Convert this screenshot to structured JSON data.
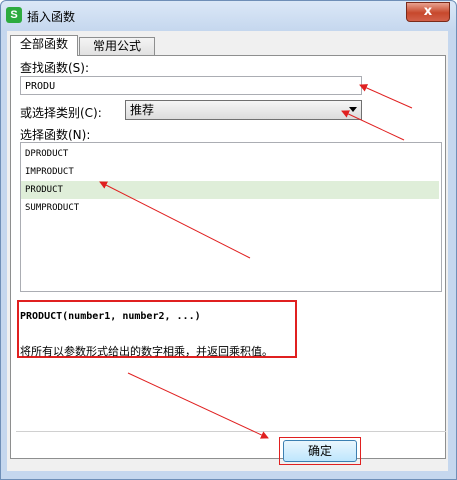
{
  "window": {
    "icon_letter": "S",
    "title": "插入函数",
    "close_label": "x"
  },
  "tabs": [
    {
      "label": "全部函数"
    },
    {
      "label": "常用公式"
    }
  ],
  "search": {
    "label": "查找函数(S):",
    "value": "PRODU"
  },
  "category": {
    "label": "或选择类别(C):",
    "selected": "推荐"
  },
  "functions": {
    "label": "选择函数(N):",
    "items": [
      "DPRODUCT",
      "IMPRODUCT",
      "PRODUCT",
      "SUMPRODUCT"
    ],
    "selected_index": 2
  },
  "description": {
    "signature": "PRODUCT(number1, number2, ...)",
    "text": "将所有以参数形式给出的数字相乘，并返回乘积值。"
  },
  "ok_button": {
    "label": "确定"
  },
  "annotation_color": "#e02020"
}
